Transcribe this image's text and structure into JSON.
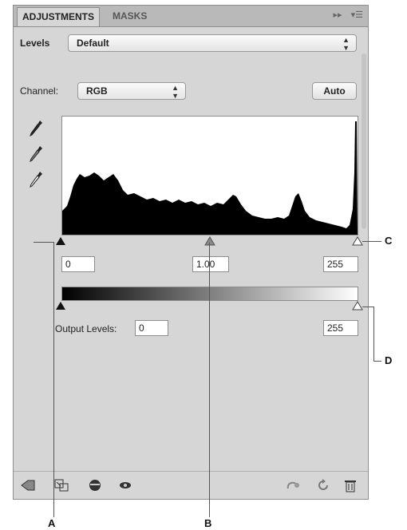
{
  "tabs": [
    {
      "label": "ADJUSTMENTS"
    },
    {
      "label": "MASKS"
    }
  ],
  "levels": {
    "label": "Levels",
    "preset": "Default"
  },
  "channel": {
    "label": "Channel:",
    "value": "RGB",
    "auto_button": "Auto"
  },
  "input_levels": {
    "black": "0",
    "gamma": "1.00",
    "white": "255"
  },
  "output_levels": {
    "label": "Output Levels:",
    "black": "0",
    "white": "255"
  },
  "callouts": {
    "a": "A",
    "b": "B",
    "c": "C",
    "d": "D"
  },
  "icons": {
    "tab_menu": [
      "expand-arrows-icon",
      "panel-menu-icon"
    ],
    "eyedroppers": [
      "black-eyedropper-icon",
      "gray-eyedropper-icon",
      "white-eyedropper-icon"
    ],
    "bottom_left": [
      "return-to-list-icon",
      "clip-to-layer-icon",
      "layer-visibility-icon",
      "view-previous-state-icon"
    ],
    "bottom_right": [
      "reset-icon",
      "refresh-icon",
      "delete-icon"
    ]
  }
}
